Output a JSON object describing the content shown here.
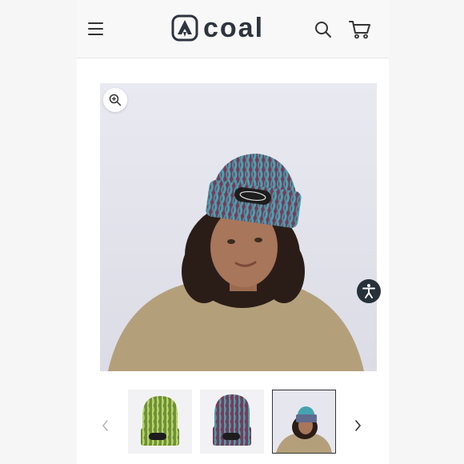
{
  "header": {
    "menu_icon": "hamburger-menu-icon",
    "logo_text": "coal",
    "logo_icon": "coal-mountain-logo",
    "search_icon": "search-icon",
    "cart_icon": "cart-icon"
  },
  "product_gallery": {
    "zoom_icon": "zoom-in-icon",
    "accessibility_icon": "accessibility-icon",
    "prev_icon": "chevron-left-icon",
    "next_icon": "chevron-right-icon",
    "thumbnails": [
      {
        "color": "green"
      },
      {
        "color": "teal"
      },
      {
        "color": "model",
        "selected": true
      }
    ]
  },
  "colors": {
    "accent": "#26313a",
    "beanie_teal": "#45a3b1",
    "beanie_maroon": "#7a3a57",
    "beanie_green": "#9cc24f",
    "sweater": "#b3a07b"
  }
}
